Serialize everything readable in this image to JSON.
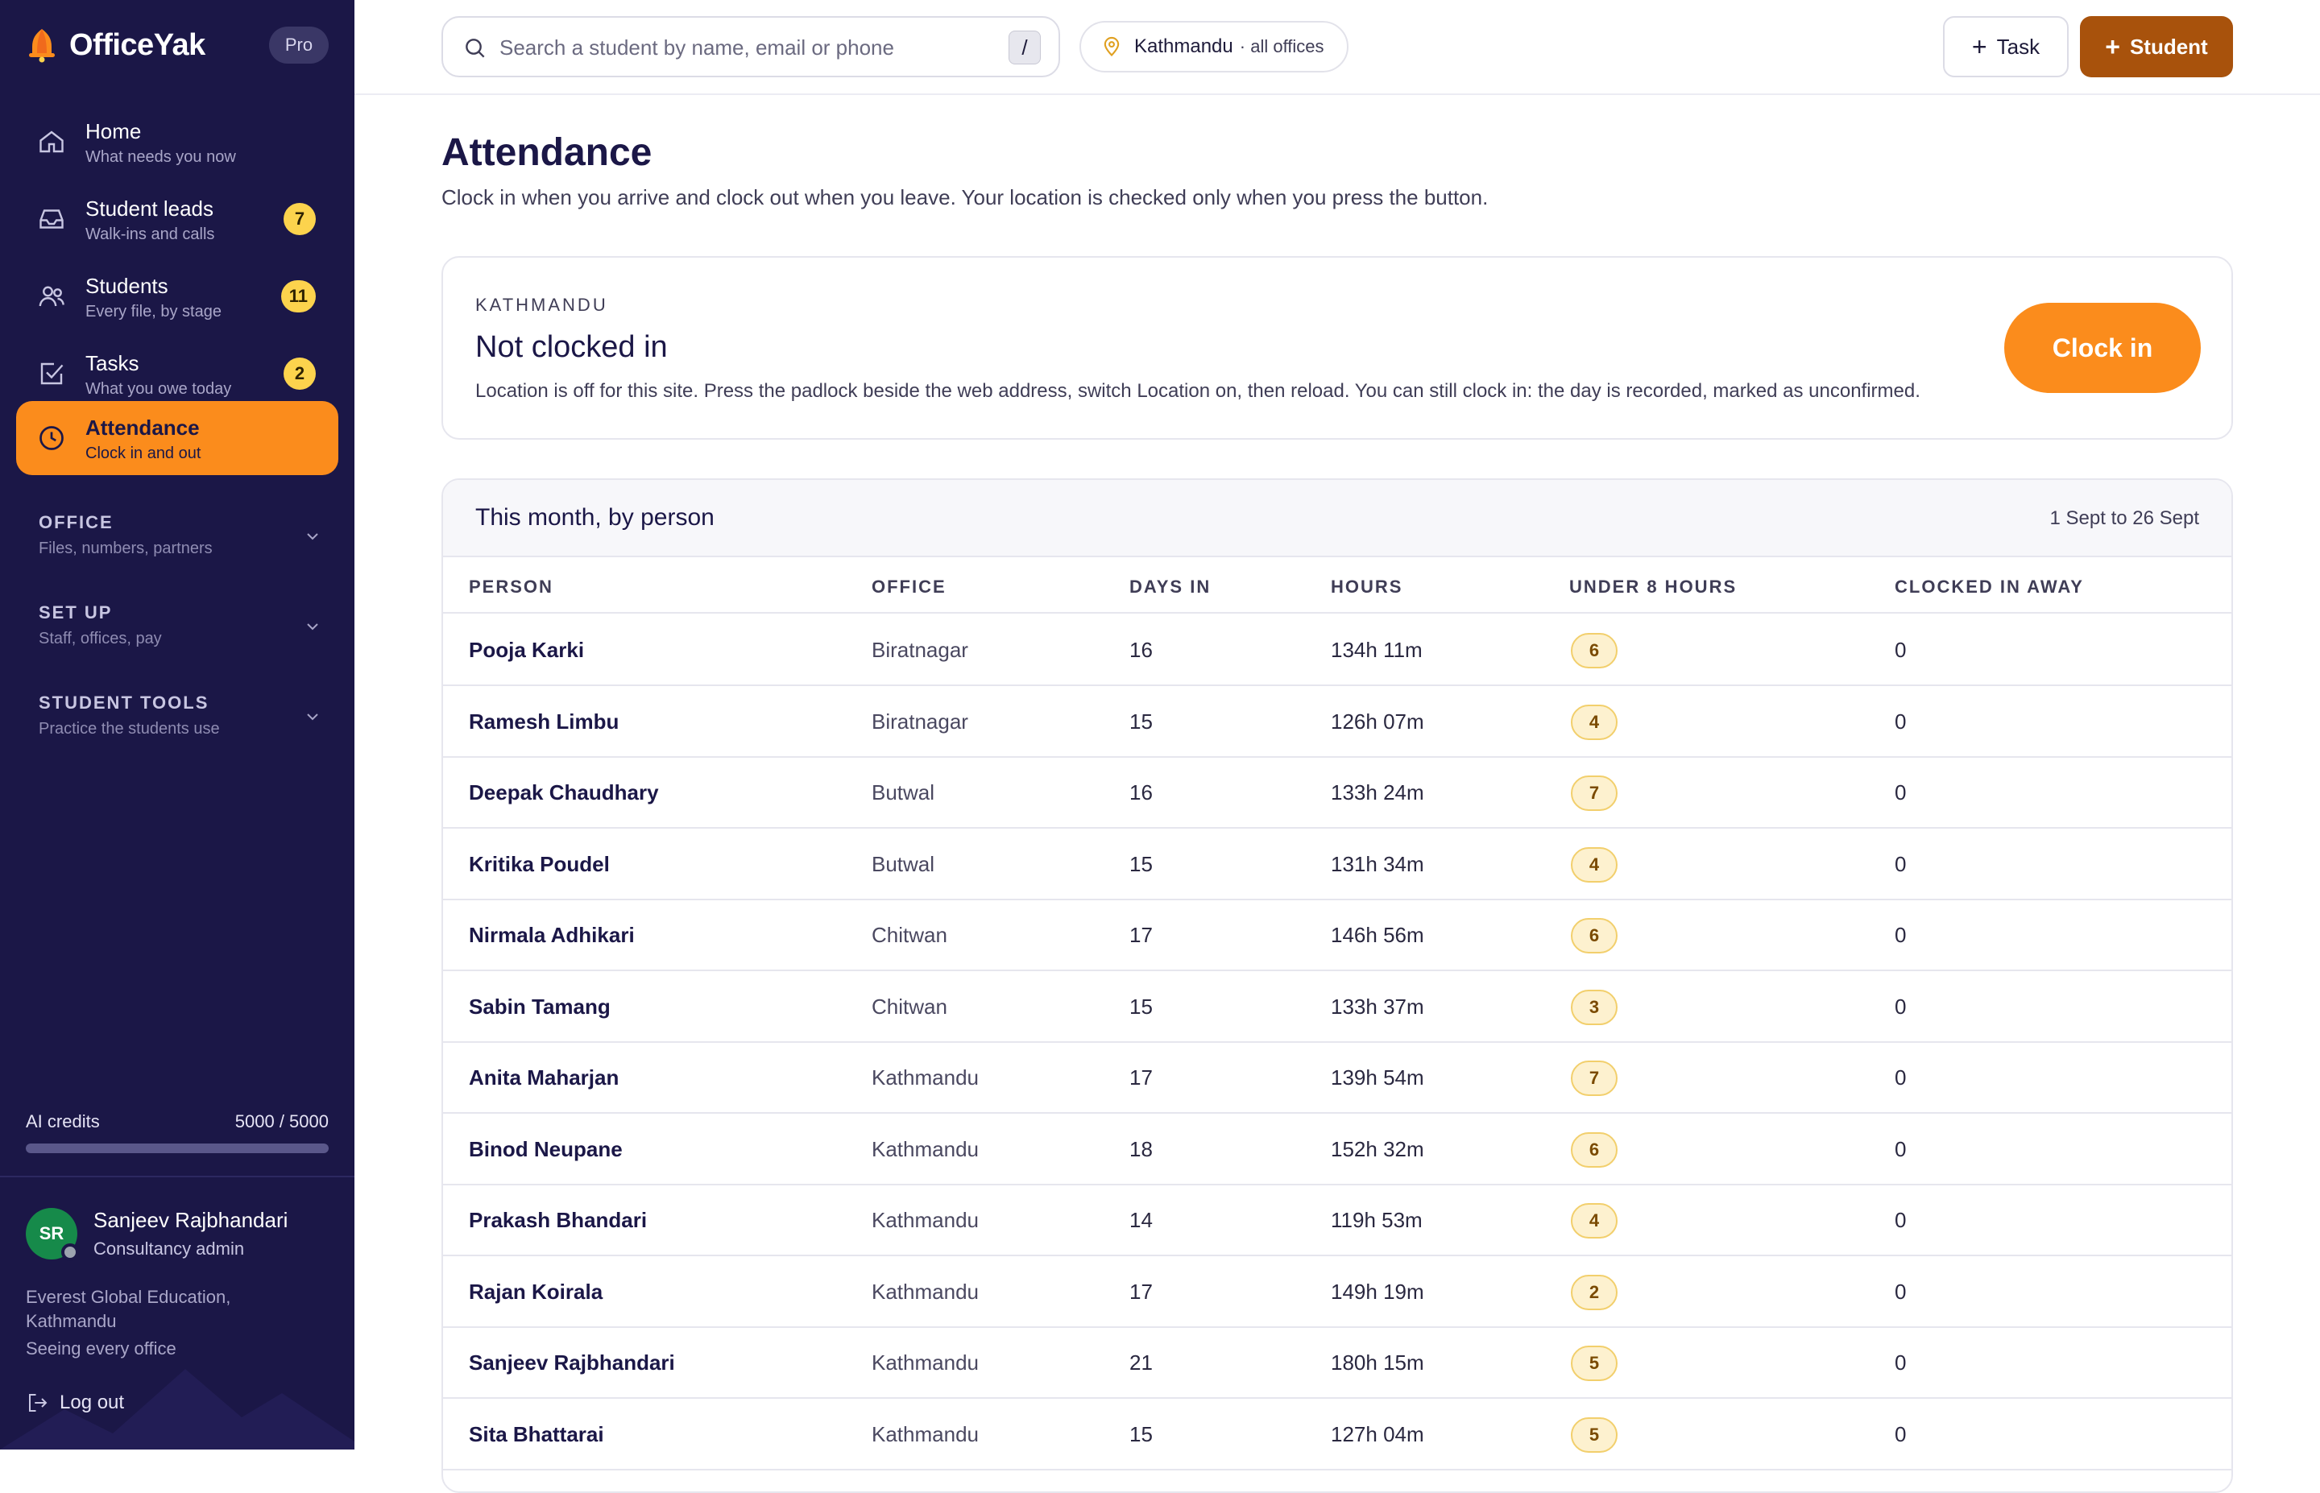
{
  "brand": {
    "name": "OfficeYak",
    "plan_badge": "Pro"
  },
  "nav": [
    {
      "title": "Home",
      "sub": "What needs you now",
      "badge": "",
      "icon": "home-icon"
    },
    {
      "title": "Student leads",
      "sub": "Walk-ins and calls",
      "badge": "7",
      "icon": "inbox-icon"
    },
    {
      "title": "Students",
      "sub": "Every file, by stage",
      "badge": "11",
      "icon": "users-icon"
    },
    {
      "title": "Tasks",
      "sub": "What you owe today",
      "badge": "2",
      "icon": "checkbox-icon"
    },
    {
      "title": "Attendance",
      "sub": "Clock in and out",
      "badge": "",
      "icon": "clock-icon",
      "active": true
    }
  ],
  "sections": [
    {
      "title": "OFFICE",
      "sub": "Files, numbers, partners"
    },
    {
      "title": "SET UP",
      "sub": "Staff, offices, pay"
    },
    {
      "title": "STUDENT TOOLS",
      "sub": "Practice the students use"
    }
  ],
  "credits": {
    "label": "AI credits",
    "value": "5000 / 5000",
    "fill_fraction": 1.0
  },
  "user": {
    "initials": "SR",
    "name": "Sanjeev Rajbhandari",
    "role": "Consultancy admin",
    "org": "Everest Global Education, Kathmandu",
    "scope": "Seeing every office",
    "logout": "Log out"
  },
  "topbar": {
    "search_placeholder": "Search a student by name, email or phone",
    "search_shortcut": "/",
    "location_city": "Kathmandu",
    "location_scope": "· all offices",
    "task_button": "Task",
    "student_button": "Student"
  },
  "page": {
    "title": "Attendance",
    "subtitle": "Clock in when you arrive and clock out when you leave. Your location is checked only when you press the button."
  },
  "status": {
    "office": "KATHMANDU",
    "state": "Not clocked in",
    "note": "Location is off for this site. Press the padlock beside the web address, switch Location on, then reload. You can still clock in: the day is recorded, marked as unconfirmed.",
    "button": "Clock in"
  },
  "table": {
    "title": "This month, by person",
    "range": "1 Sept to 26 Sept",
    "columns": [
      "PERSON",
      "OFFICE",
      "DAYS IN",
      "HOURS",
      "UNDER 8 HOURS",
      "CLOCKED IN AWAY"
    ],
    "rows": [
      [
        "Pooja Karki",
        "Biratnagar",
        "16",
        "134h 11m",
        "6",
        "0"
      ],
      [
        "Ramesh Limbu",
        "Biratnagar",
        "15",
        "126h 07m",
        "4",
        "0"
      ],
      [
        "Deepak Chaudhary",
        "Butwal",
        "16",
        "133h 24m",
        "7",
        "0"
      ],
      [
        "Kritika Poudel",
        "Butwal",
        "15",
        "131h 34m",
        "4",
        "0"
      ],
      [
        "Nirmala Adhikari",
        "Chitwan",
        "17",
        "146h 56m",
        "6",
        "0"
      ],
      [
        "Sabin Tamang",
        "Chitwan",
        "15",
        "133h 37m",
        "3",
        "0"
      ],
      [
        "Anita Maharjan",
        "Kathmandu",
        "17",
        "139h 54m",
        "7",
        "0"
      ],
      [
        "Binod Neupane",
        "Kathmandu",
        "18",
        "152h 32m",
        "6",
        "0"
      ],
      [
        "Prakash Bhandari",
        "Kathmandu",
        "14",
        "119h 53m",
        "4",
        "0"
      ],
      [
        "Rajan Koirala",
        "Kathmandu",
        "17",
        "149h 19m",
        "2",
        "0"
      ],
      [
        "Sanjeev Rajbhandari",
        "Kathmandu",
        "21",
        "180h 15m",
        "5",
        "0"
      ],
      [
        "Sita Bhattarai",
        "Kathmandu",
        "15",
        "127h 04m",
        "5",
        "0"
      ]
    ]
  },
  "colors": {
    "sidebar_bg": "#1b1747",
    "accent_orange": "#fb8c1c",
    "student_button": "#a8520c",
    "badge_yellow": "#fcd34d",
    "avatar_green": "#168a4a"
  }
}
